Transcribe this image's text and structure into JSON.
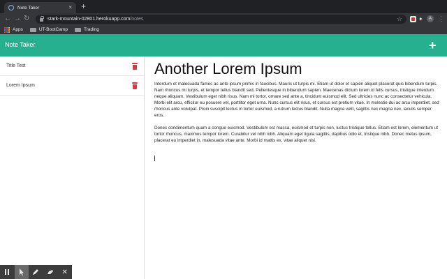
{
  "browser": {
    "tab_title": "Note Taker",
    "tab_close": "×",
    "new_tab": "+",
    "url_host": "stark-mountain-02801.herokuapp.com",
    "url_path": "/notes",
    "bookmarks": [
      {
        "label": "Apps",
        "icon": "apps-grid-icon"
      },
      {
        "label": "UT-BootCamp",
        "icon": "folder-icon"
      },
      {
        "label": "Trading",
        "icon": "folder-icon"
      }
    ]
  },
  "app": {
    "brand": "Note Taker",
    "add_button": "+",
    "accent_color": "#26b08f",
    "notes": [
      {
        "title": "Title Test"
      },
      {
        "title": "Lorem Ipsum"
      }
    ],
    "active_note": {
      "title": "Another Lorem Ipsum",
      "paragraphs": [
        "Interdum et malesuada fames ac ante ipsum primis in faucibus. Mauris ut turpis mi. Etiam ut dolor et sapien aliquet placerat quis bibendum turpis. Nam rhoncus mi turpis, et tempor tellus blandit sed. Pellentesque in bibendum sapien. Maecenas dictum lorem id felis cursus, tristique interdum neque aliquam. Vestibulum eget nibh risus. Nam mi tortor, ornare sed ante a, tincidunt euismod elit. Sed ultricies nunc ac consectetur vehicula. Morbi elit arcu, efficitur eu posuere vel, porttitor eget urna. Nunc cursus elit risus, et cursus est pretium vitae. In molestie dui ac arcu imperdiet, sed rhoncus ante volutpat. Proin suscipit lectus in tortor euismod, a rutrum lectus blandit. Nulla magna velit, sagittis nec magna nec, iaculis semper eros.",
        "Donec condimentum quam a congue euismod. Vestibulum est massa, euismod et turpis non, luctus tristique tellus. Etiam est lorem, elementum ut tortor rhoncus, maximus tempor lorem. Curabitur vel nibh nibh. Aliquam eget ligula sagittis, dapibus odio et, tristique nibh. Donec metus ipsum, placerat eu imperdiet in, malesuada vitae ante. Morbi id mattis ex, vitae aliquet nisi."
      ]
    }
  },
  "annotation_toolbar": {
    "tools": [
      "pause-icon",
      "pointer-icon",
      "pen-icon",
      "highlighter-icon",
      "close-icon"
    ],
    "close_glyph": "✕"
  }
}
